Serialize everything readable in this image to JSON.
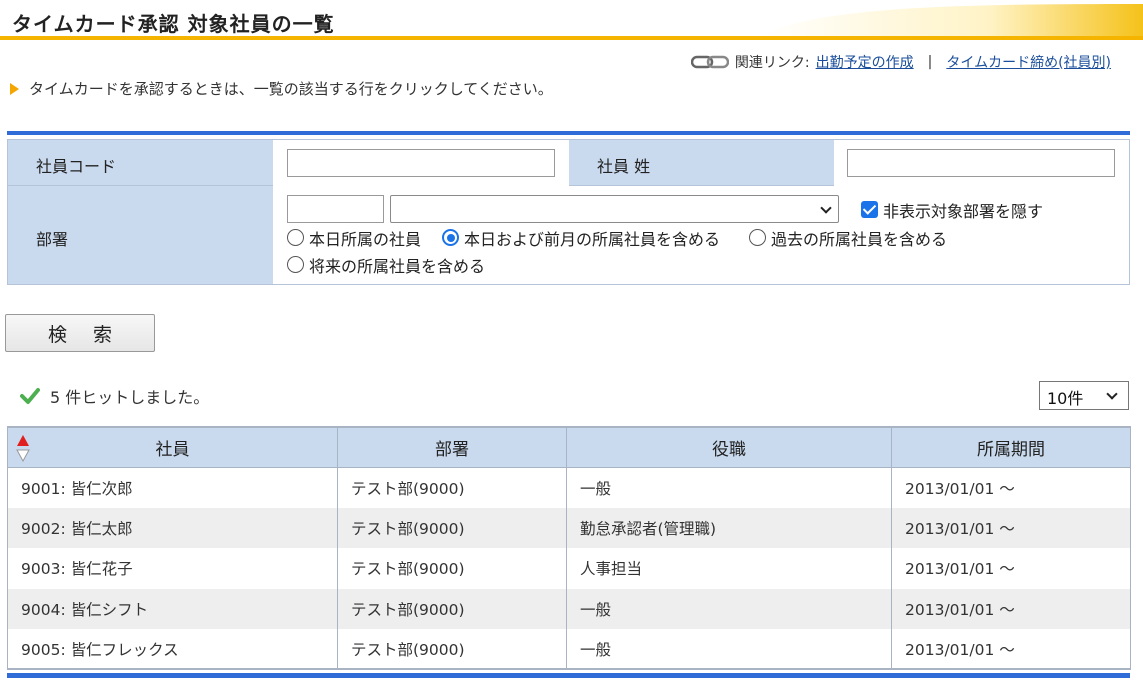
{
  "header": {
    "title": "タイムカード承認 対象社員の一覧"
  },
  "related_links": {
    "label": "関連リンク:",
    "link1": "出勤予定の作成",
    "separator": "|",
    "link2": "タイムカード締め(社員別)"
  },
  "instruction": "タイムカードを承認するときは、一覧の該当する行をクリックしてください。",
  "form": {
    "employee_code_label": "社員コード",
    "employee_code_value": "",
    "surname_label": "社員 姓",
    "surname_value": "",
    "department_label": "部署",
    "department_code_value": "",
    "department_select_value": "",
    "hide_checkbox_label": "非表示対象部署を隠す",
    "hide_checkbox_checked": true,
    "radio_options": [
      {
        "label": "本日所属の社員",
        "checked": false
      },
      {
        "label": "本日および前月の所属社員を含める",
        "checked": true
      },
      {
        "label": "過去の所属社員を含める",
        "checked": false
      },
      {
        "label": "将来の所属社員を含める",
        "checked": false
      }
    ]
  },
  "search_button": "検 索",
  "result_message": "5 件ヒットしました。",
  "page_size": "10件",
  "table": {
    "columns": [
      "社員",
      "部署",
      "役職",
      "所属期間"
    ],
    "rows": [
      [
        "9001:  皆仁次郎",
        "テスト部(9000)",
        "一般",
        "2013/01/01 ～"
      ],
      [
        "9002:  皆仁太郎",
        "テスト部(9000)",
        "勤怠承認者(管理職)",
        "2013/01/01 ～"
      ],
      [
        "9003:  皆仁花子",
        "テスト部(9000)",
        "人事担当",
        "2013/01/01 ～"
      ],
      [
        "9004:  皆仁シフト",
        "テスト部(9000)",
        "一般",
        "2013/01/01 ～"
      ],
      [
        "9005:  皆仁フレックス",
        "テスト部(9000)",
        "一般",
        "2013/01/01 ～"
      ]
    ]
  },
  "colors": {
    "accent_blue": "#2f6cd8",
    "header_cell": "#c9d9ee",
    "title_orange": "#f5b400",
    "link": "#1a4e9b"
  }
}
